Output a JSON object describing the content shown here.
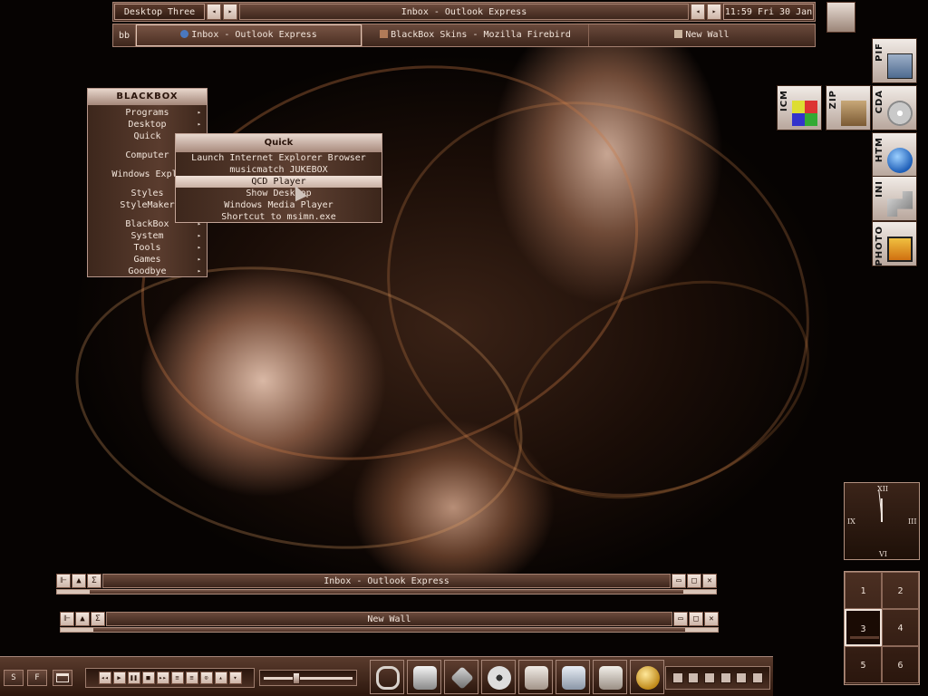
{
  "toolbar": {
    "workspace_name": "Desktop Three",
    "window_title": "Inbox - Outlook Express",
    "clock": "11:59 Fri 30 Jan",
    "prev_glyph": "◂",
    "next_glyph": "▸"
  },
  "taskbar": {
    "label": "bb",
    "tasks": [
      {
        "label": "Inbox - Outlook Express",
        "icon": "outlook-icon",
        "active": true
      },
      {
        "label": "BlackBox Skins - Mozilla Firebird",
        "icon": "firebird-icon",
        "active": false
      },
      {
        "label": "New Wall",
        "icon": "folder-icon",
        "active": false
      }
    ]
  },
  "root_menu": {
    "title": "BLACKBOX",
    "items": [
      {
        "label": "Programs",
        "submenu": true
      },
      {
        "label": "Desktop",
        "submenu": true
      },
      {
        "label": "Quick",
        "submenu": false
      },
      {
        "label": "Computer",
        "submenu": false
      },
      {
        "label": "Windows Explo",
        "submenu": false
      },
      {
        "label": "Styles",
        "submenu": false
      },
      {
        "label": "StyleMaker",
        "submenu": false
      },
      {
        "label": "BlackBox",
        "submenu": true
      },
      {
        "label": "System",
        "submenu": true
      },
      {
        "label": "Tools",
        "submenu": true
      },
      {
        "label": "Games",
        "submenu": true
      },
      {
        "label": "Goodbye",
        "submenu": true
      }
    ],
    "submenu_glyph": "▸"
  },
  "quick_menu": {
    "title": "Quick",
    "items": [
      "Launch Internet Explorer Browser",
      "musicmatch JUKEBOX",
      "QCD Player",
      "Show Desktop",
      "Windows Media Player",
      "Shortcut to msimn.exe"
    ],
    "hovered_index": 2
  },
  "desktop_icons": [
    {
      "tag": "PIF",
      "icon": "pif-shortcut-icon"
    },
    {
      "tag": "ICM",
      "icon": "color-profile-icon"
    },
    {
      "tag": "ZIP",
      "icon": "zip-archive-icon"
    },
    {
      "tag": "CDA",
      "icon": "cd-audio-icon"
    },
    {
      "tag": "HTM",
      "icon": "html-document-icon"
    },
    {
      "tag": "INI",
      "icon": "settings-file-icon"
    },
    {
      "tag": "PHOTO",
      "icon": "photo-file-icon"
    }
  ],
  "clock_widget": {
    "numerals": [
      "XII",
      "III",
      "VI",
      "IX"
    ],
    "hour": 11,
    "minute": 59
  },
  "pager": {
    "workspaces": [
      "1",
      "2",
      "3",
      "4",
      "5",
      "6"
    ],
    "active": 3
  },
  "minimized_windows": [
    {
      "title": "Inbox - Outlook Express"
    },
    {
      "title": "New Wall"
    }
  ],
  "window_buttons": {
    "pin": "⊩",
    "shade": "▲",
    "sigma": "Σ",
    "minimize": "▭",
    "maximize": "□",
    "close": "✕"
  },
  "bottom_bar": {
    "left_buttons": [
      "S",
      "F"
    ],
    "media_buttons": [
      "◂◂",
      "▶",
      "❚❚",
      "■",
      "▸▸",
      "≡",
      "≡",
      "⊙",
      "▴",
      "▾"
    ],
    "volume_level": 0.36,
    "launchers": [
      "paperclip-icon",
      "drive-icon",
      "tools-icon",
      "film-reel-icon",
      "folder-icon",
      "mail-icon",
      "photos-icon",
      "power-icon"
    ]
  },
  "colors": {
    "accent": "#7a5646",
    "menu_highlight": "#f0e2d9",
    "text": "#f3e6dc",
    "background": "#050201"
  }
}
